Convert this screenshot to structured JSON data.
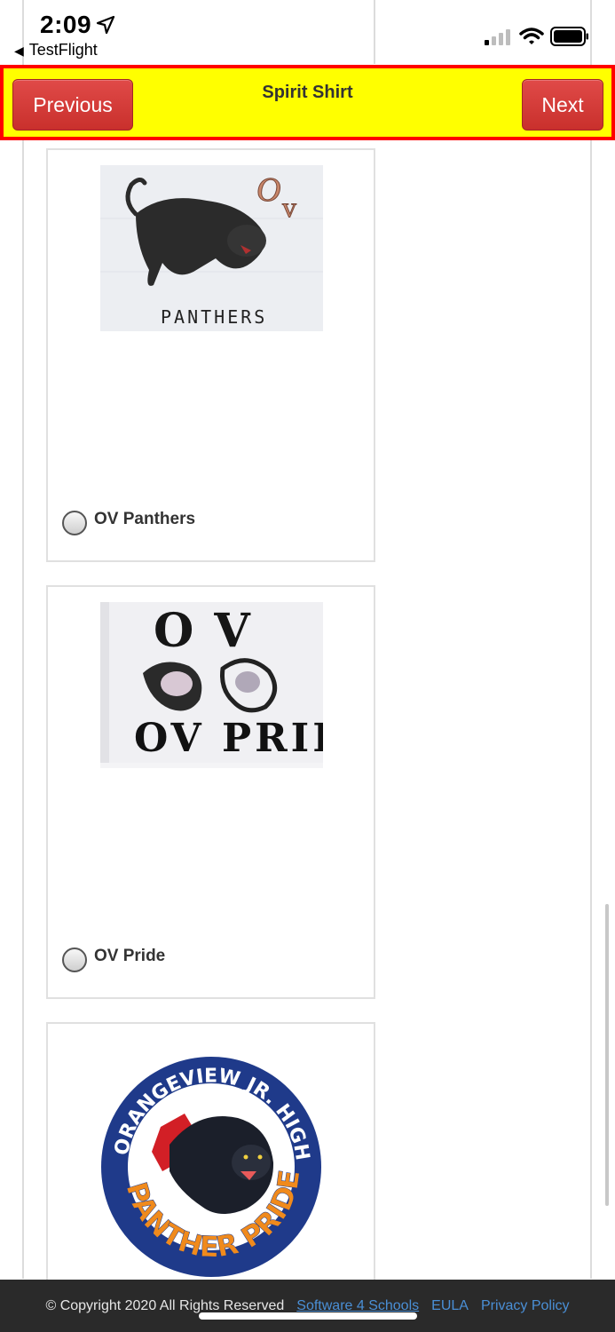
{
  "status_bar": {
    "time": "2:09",
    "back_app": "TestFlight",
    "icons": [
      "location-arrow-icon",
      "cellular-signal-icon",
      "wifi-icon",
      "battery-icon"
    ]
  },
  "header": {
    "title": "Spirit Shirt",
    "prev_label": "Previous",
    "next_label": "Next",
    "colors": {
      "background": "#ffff00",
      "border": "#ff0000",
      "button": "#c9302c"
    }
  },
  "options": [
    {
      "label": "OV Panthers",
      "image_text": "PANTHERS",
      "selected": false
    },
    {
      "label": "OV Pride",
      "image_text": "OV PRIDE",
      "selected": false
    },
    {
      "label": "",
      "image_text": "ORANGEVIEW JR. HIGH PANTHER PRIDE",
      "selected": false
    }
  ],
  "footer": {
    "copyright": "© Copyright 2020 All Rights Reserved",
    "links": [
      "Software 4 Schools",
      "EULA",
      "Privacy Policy"
    ]
  }
}
